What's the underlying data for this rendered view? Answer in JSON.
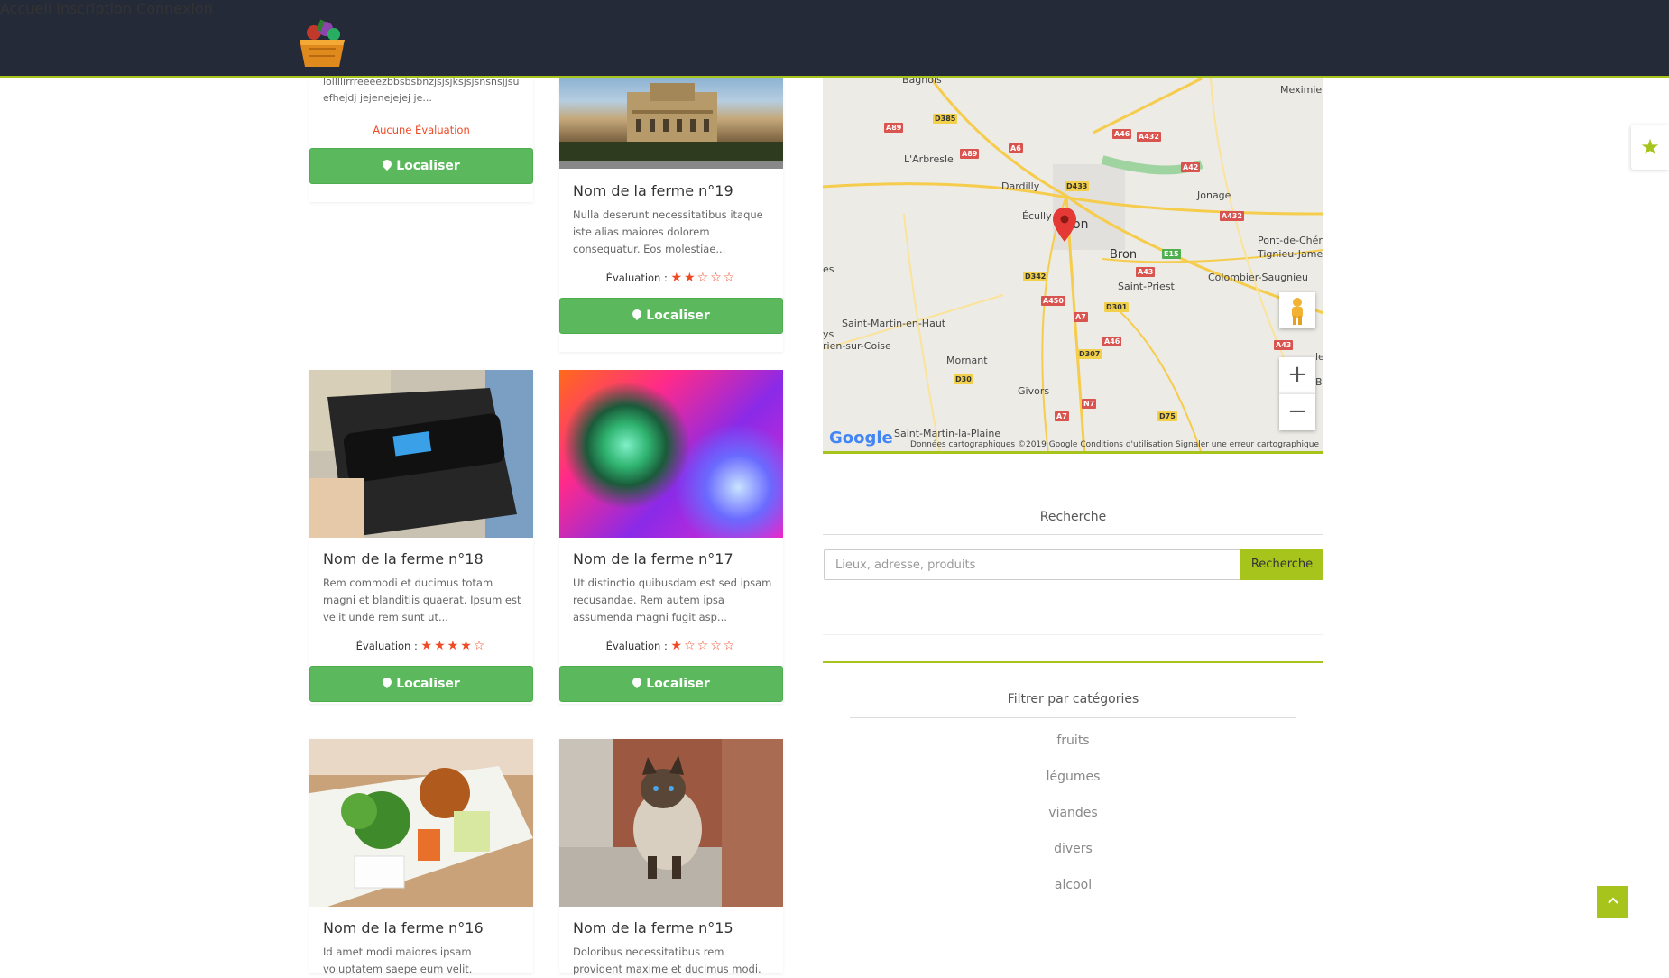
{
  "nav": {
    "home": "Accueil",
    "signup": "Inscription",
    "login": "Connexion"
  },
  "cards": {
    "c0": {
      "desc": "lollllirrreeeezbbsbsbnzjsjsjksjsjsnsnsjjsu efhejdj jejenejejej je...",
      "no_eval": "Aucune Évaluation",
      "btn": "Localiser"
    },
    "c19": {
      "title": "Nom de la ferme n°19",
      "desc": "Nulla deserunt necessitatibus itaque iste alias maiores dolorem consequatur. Eos molestiae...",
      "eval_label": "Évaluation :",
      "stars": "★★☆☆☆",
      "rating": 2,
      "btn": "Localiser"
    },
    "c18": {
      "title": "Nom de la ferme n°18",
      "desc": "Rem commodi et ducimus totam magni et blanditiis quaerat. Ipsum est velit unde rem sunt ut...",
      "eval_label": "Évaluation :",
      "stars": "★★★★☆",
      "rating": 4,
      "btn": "Localiser"
    },
    "c17": {
      "title": "Nom de la ferme n°17",
      "desc": "Ut distinctio quibusdam est sed ipsam recusandae. Rem autem ipsa assumenda magni fugit asp...",
      "eval_label": "Évaluation :",
      "stars": "★☆☆☆☆",
      "rating": 1,
      "btn": "Localiser"
    },
    "c16": {
      "title": "Nom de la ferme n°16",
      "desc": "Id amet modi maiores ipsam voluptatem saepe eum velit."
    },
    "c15": {
      "title": "Nom de la ferme n°15",
      "desc": "Doloribus necessitatibus rem provident maxime et ducimus modi."
    }
  },
  "map": {
    "labels": [
      "Bagnols",
      "Meximie",
      "L'Arbresle",
      "Dardilly",
      "Écully",
      "on",
      "Jonage",
      "Bron",
      "Pont-de-Chéru",
      "Tignieu-Jame",
      "Saint-Priest",
      "Colombier-Saugnieu",
      "es",
      "Saint-Martin-en-Haut",
      "ys",
      "rien-sur-Coise",
      "Mornant",
      "Givors",
      "Saint-Martin-la-Plaine",
      "le",
      "B"
    ],
    "roads": [
      "A89",
      "D385",
      "A6",
      "A46",
      "A432",
      "A89",
      "A42",
      "D433",
      "A432",
      "E15",
      "D342",
      "A43",
      "A450",
      "D301",
      "A7",
      "A46",
      "D307",
      "A43",
      "D30",
      "N7",
      "A7",
      "D75"
    ],
    "footer": "Données cartographiques ©2019 Google   Conditions d'utilisation   Signaler une erreur cartographique",
    "google": "Google",
    "zoom_in": "+",
    "zoom_out": "−"
  },
  "search": {
    "title": "Recherche",
    "placeholder": "Lieux, adresse, produits",
    "button": "Recherche"
  },
  "filter": {
    "title": "Filtrer par catégories",
    "categories": [
      "fruits",
      "légumes",
      "viandes",
      "divers",
      "alcool"
    ]
  },
  "colors": {
    "accent": "#a6c41b",
    "header": "#252a38",
    "button": "#5cb85c",
    "stars": "#f04a25"
  }
}
